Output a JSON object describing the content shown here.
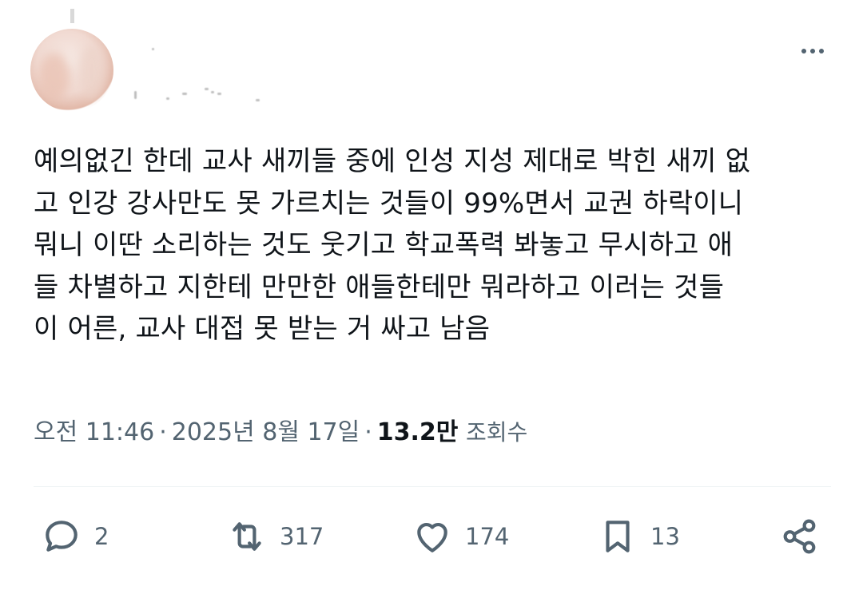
{
  "tweet": {
    "lines": [
      "예의없긴 한데 교사 새끼들 중에 인성 지성 제대로 박힌 새끼 없",
      "고 인강 강사만도 못 가르치는 것들이 99%면서 교권 하락이니",
      "뭐니 이딴 소리하는 것도 웃기고 학교폭력 봐놓고 무시하고 애",
      "들 차별하고 지한테 만만한 애들한테만 뭐라하고 이러는 것들",
      "이 어른, 교사 대접 못 받는 거 싸고 남음"
    ]
  },
  "meta": {
    "time": "오전 11:46",
    "dot": "·",
    "date": "2025년 8월 17일",
    "views_count": "13.2만",
    "views_label": "조회수"
  },
  "actions": {
    "reply": {
      "icon": "reply-icon",
      "count": "2"
    },
    "retweet": {
      "icon": "retweet-icon",
      "count": "317"
    },
    "like": {
      "icon": "heart-icon",
      "count": "174"
    },
    "bookmark": {
      "icon": "bookmark-icon",
      "count": "13"
    },
    "share": {
      "icon": "share-icon"
    }
  },
  "colors": {
    "text": "#0f1419",
    "secondary": "#536471",
    "divider": "#eff3f4"
  }
}
